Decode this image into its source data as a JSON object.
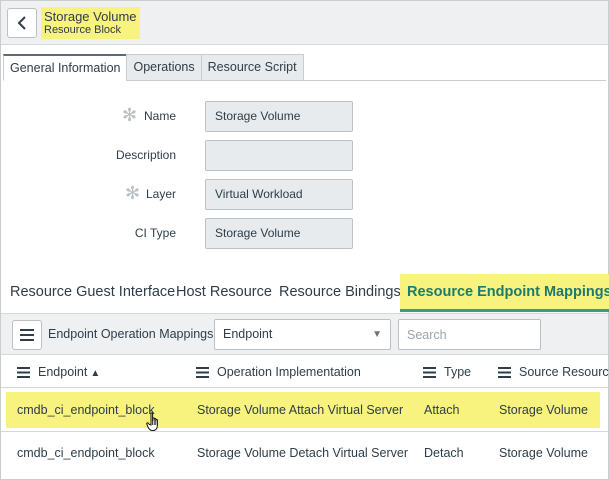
{
  "header": {
    "title": "Storage Volume",
    "subtitle": "Resource Block"
  },
  "tabs": [
    {
      "label": "General Information",
      "active": true
    },
    {
      "label": "Operations",
      "active": false
    },
    {
      "label": "Resource Script",
      "active": false
    }
  ],
  "form": {
    "name_label": "Name",
    "name_value": "Storage Volume",
    "description_label": "Description",
    "description_value": "",
    "layer_label": "Layer",
    "layer_value": "Virtual Workload",
    "citype_label": "CI Type",
    "citype_value": "Storage Volume"
  },
  "section_tabs": [
    {
      "label": "Resource Guest Interface",
      "active": false
    },
    {
      "label": "Host Resource",
      "active": false
    },
    {
      "label": "Resource Bindings",
      "active": false
    },
    {
      "label": "Resource Endpoint Mappings",
      "active": true
    }
  ],
  "list": {
    "title": "Endpoint Operation Mappings",
    "filter_value": "Endpoint",
    "search_placeholder": "Search",
    "columns": [
      {
        "label": "Endpoint",
        "sort": "▲"
      },
      {
        "label": "Operation Implementation"
      },
      {
        "label": "Type"
      },
      {
        "label": "Source Resource"
      }
    ],
    "rows": [
      {
        "endpoint": "cmdb_ci_endpoint_block",
        "operation": "Storage Volume Attach Virtual Server",
        "type": "Attach",
        "source": "Storage Volume",
        "highlighted": true
      },
      {
        "endpoint": "cmdb_ci_endpoint_block",
        "operation": "Storage Volume Detach Virtual Server",
        "type": "Detach",
        "source": "Storage Volume",
        "highlighted": false
      }
    ]
  },
  "colors": {
    "highlight": "#f7f37e",
    "accent": "#2aa190",
    "text": "#2e3d49"
  }
}
